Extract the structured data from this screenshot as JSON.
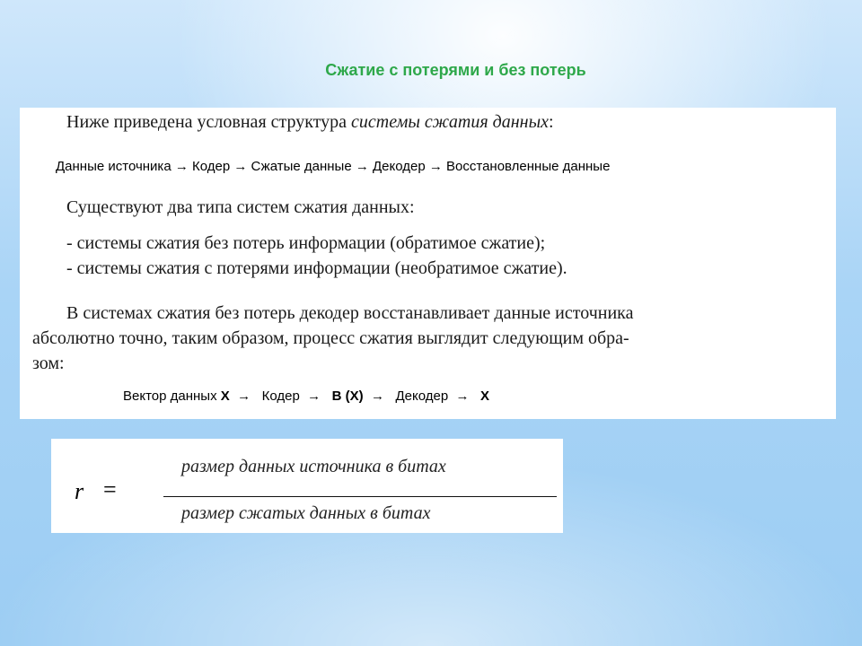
{
  "slide": {
    "title": "Сжатие с потерями и без потерь"
  },
  "content": {
    "intro_prefix": "Ниже приведена условная структура ",
    "intro_italic": "системы сжатия данных",
    "intro_suffix": ":",
    "flow1": "Данные источника → Кодер → Сжатые данные → Декодер → Восстановленные данные",
    "types_heading": "Существуют два типа систем сжатия данных:",
    "types": [
      "-   системы сжатия без потерь информации (обратимое сжатие);",
      "-   системы сжатия с потерями информации (необратимое сжатие)."
    ],
    "para_line1": "В системах сжатия без потерь декодер восстанавливает данные источника",
    "para_line2": "абсолютно точно, таким образом, процесс сжатия выглядит следующим обра-",
    "para_line3": "зом:",
    "flow2": {
      "part1": "Вектор данных ",
      "x1": "X",
      "arrow1": "  →   ",
      "coder": "Кодер",
      "arrow2": "  →   ",
      "bx": "B (X)",
      "arrow3": "  →   ",
      "decoder": "Декодер",
      "arrow4": "  →   ",
      "x2": "X"
    }
  },
  "formula": {
    "lhs": "r",
    "eq": "=",
    "numerator": "размер данных источника в битах",
    "denominator": "размер сжатых данных в битах"
  }
}
